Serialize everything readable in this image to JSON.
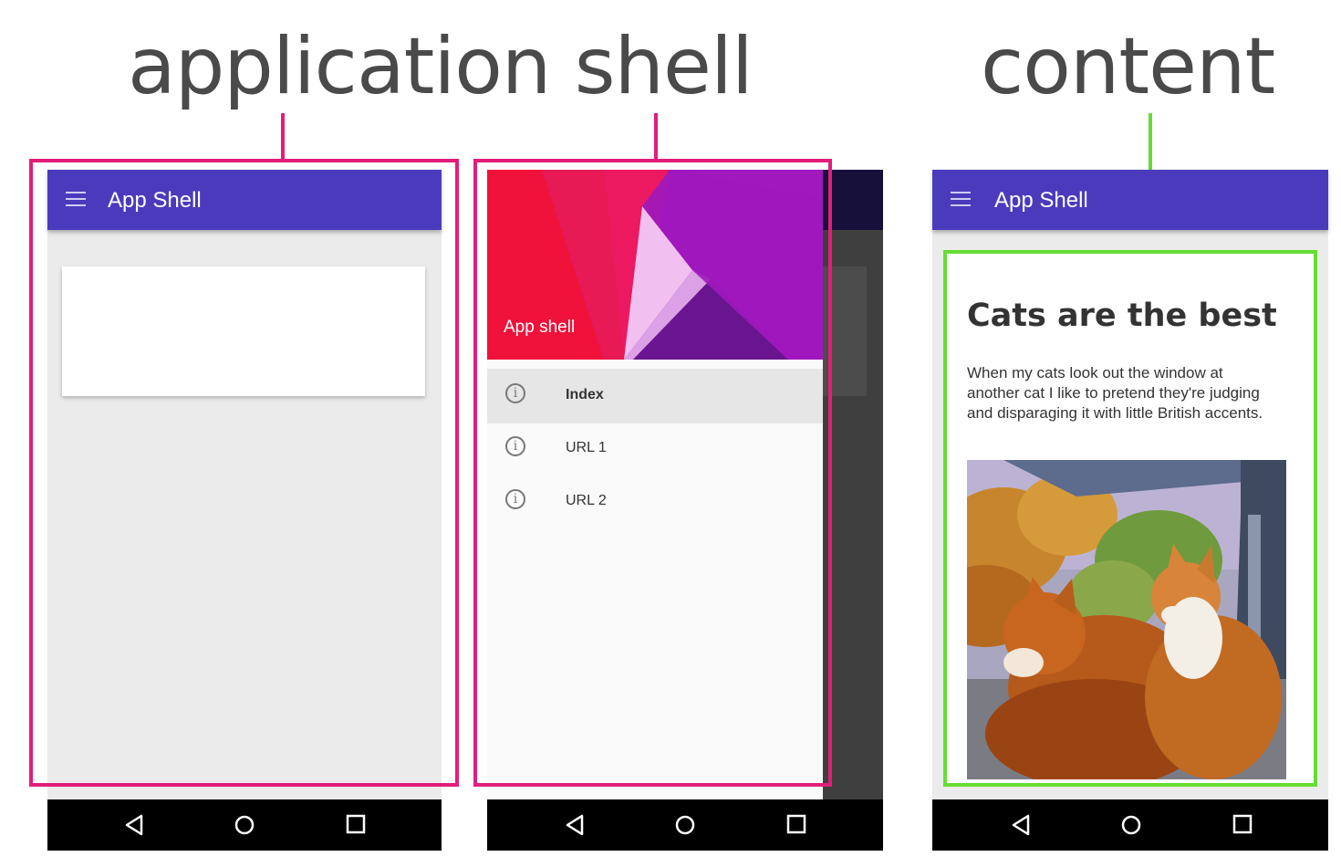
{
  "labels": {
    "application_shell": "application shell",
    "content": "content"
  },
  "phones": [
    {
      "app_title": "App Shell"
    },
    {
      "drawer_header": "App shell",
      "drawer_items": [
        "Index",
        "URL 1",
        "URL 2"
      ]
    },
    {
      "app_title": "App Shell",
      "article": {
        "title": "Cats are the best",
        "body": "When my cats look out the window at another cat I like to pretend they're judging and disparaging it with little British accents."
      }
    }
  ],
  "icons": {
    "menu": "menu-icon",
    "info": "info-icon",
    "back": "back-nav-icon",
    "home": "home-nav-icon",
    "recents": "recents-nav-icon"
  },
  "colors": {
    "app_bar": "#4a3bbd",
    "shell_outline": "#e21e79",
    "content_outline": "#66dd33"
  }
}
